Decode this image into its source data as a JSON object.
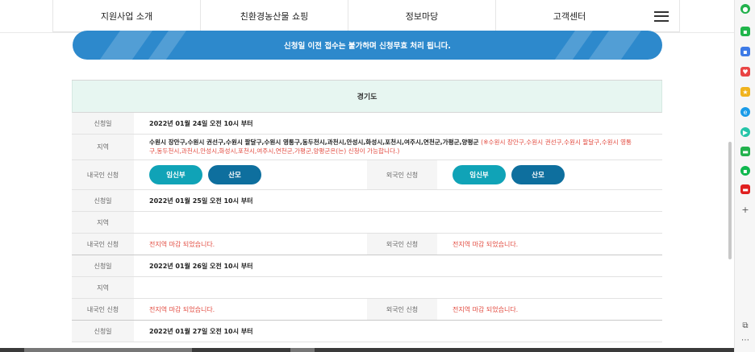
{
  "nav": {
    "items": [
      {
        "label": "지원사업 소개"
      },
      {
        "label": "친환경농산물 쇼핑"
      },
      {
        "label": "정보마당"
      },
      {
        "label": "고객센터"
      }
    ]
  },
  "banner": {
    "text": "신청일 이전 접수는 불가하며 신청무효 처리 됩니다."
  },
  "region": {
    "title": "경기도",
    "labels": {
      "date": "신청일",
      "area": "지역",
      "domestic": "내국인 신청",
      "foreign": "외국인 신청"
    },
    "buttons": {
      "pregnant": "임신부",
      "mother": "산모"
    },
    "closed_text": "전지역 마감 되었습니다.",
    "blocks": [
      {
        "date": "2022년 01월 24일 오전 10시 부터",
        "area_main": "수원시 장안구,수원시 권선구,수원시 팔달구,수원시 영통구,동두천시,과천시,안성시,화성시,포천시,여주시,연천군,가평군,양평군",
        "area_note": "(※수원시 장안구,수원시 권선구,수원시 팔달구,수원시 영통구,동두천시,과천시,안성시,화성시,포천시,여주시,연천군,가평군,양평군은(는) 신청이 가능합니다.)"
      },
      {
        "date": "2022년 01월 25일 오전 10시 부터"
      },
      {
        "date": "2022년 01월 26일 오전 10시 부터"
      },
      {
        "date": "2022년 01월 27일 오전 10시 부터"
      }
    ]
  },
  "colors": {
    "banner": "#2d89cc",
    "region_header": "#e7f6f1",
    "pill_teal": "#10a3b7",
    "pill_navy": "#0e6f9e",
    "closed_red": "#e2483d"
  },
  "sidebar": {
    "icons": [
      "green-circle-icon",
      "green-square-icon",
      "blue-app-icon",
      "red-pocket-icon",
      "yellow-star-icon",
      "edge-icon",
      "teal-play-icon",
      "green-chat-icon",
      "green-app-icon",
      "red-app-icon",
      "plus-icon",
      "external-link-icon",
      "more-icon"
    ]
  }
}
